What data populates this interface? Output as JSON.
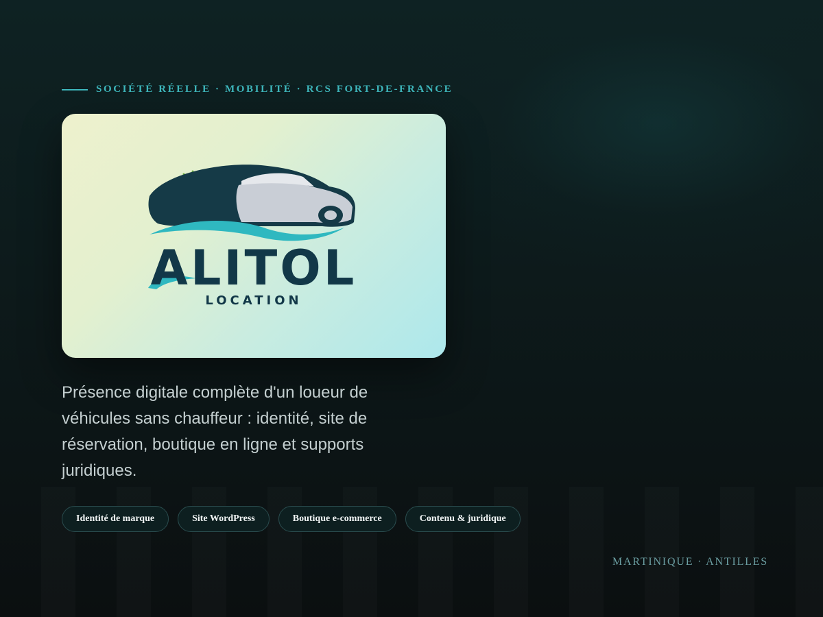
{
  "eyebrow": {
    "text": "SOCIÉTÉ RÉELLE · MOBILITÉ · RCS FORT-DE-FRANCE"
  },
  "logo": {
    "name": "ALITOL",
    "subtitle": "LOCATION",
    "colors": {
      "navy": "#123848",
      "teal": "#2fb8c0",
      "palm_green": "#6fb043",
      "car_silver": "#c9ced6"
    }
  },
  "description": "Présence digitale complète d'un loueur de véhicules sans chauffeur : identité, site de réservation, boutique en ligne et supports juridiques.",
  "tags": [
    "Identité de marque",
    "Site WordPress",
    "Boutique e-commerce",
    "Contenu & juridique"
  ],
  "location": "MARTINIQUE · ANTILLES",
  "colors": {
    "accent": "#3fb8bd",
    "background": "#0d1a1b",
    "tag_border": "#2a4c4e"
  }
}
